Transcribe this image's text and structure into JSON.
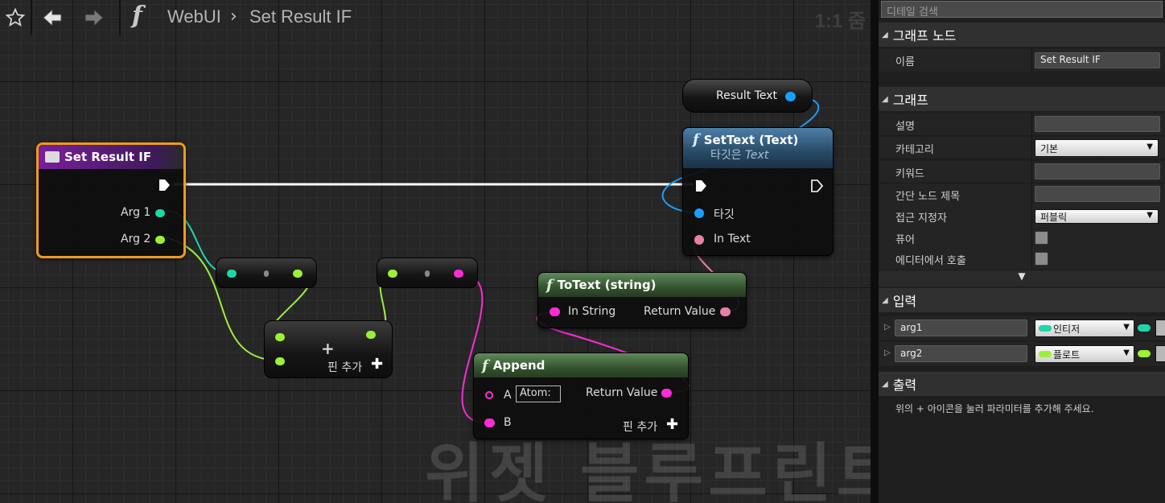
{
  "toolbar": {
    "breadcrumb_root": "WebUI",
    "breadcrumb_current": "Set Result IF",
    "zoom": "1:1 줌"
  },
  "watermark": "위젯 블루프린트",
  "nodes": {
    "entry": {
      "title": "Set Result IF",
      "arg1": "Arg 1",
      "arg2": "Arg 2"
    },
    "make_array": {
      "add_pin": "핀 추가"
    },
    "result_text": {
      "label": "Result Text"
    },
    "set_text": {
      "title": "SetText (Text)",
      "subtitle_prefix": "타깃은 ",
      "subtitle_target": "Text",
      "target": "타깃",
      "in_text": "In Text"
    },
    "to_text": {
      "title": "ToText (string)",
      "in_string": "In String",
      "return_value": "Return Value"
    },
    "append": {
      "title": "Append",
      "a": "A",
      "a_default": "Atom:",
      "b": "B",
      "return_value": "Return Value",
      "add_pin": "핀 추가"
    }
  },
  "details": {
    "search_placeholder": "디테일 검색",
    "graph_node_section": "그래프 노드",
    "name_label": "이름",
    "name_value": "Set Result IF",
    "graph_section": "그래프",
    "description_label": "설명",
    "category_label": "카테고리",
    "category_value": "기본",
    "keywords_label": "키워드",
    "compact_title_label": "간단 노드 제목",
    "access_label": "접근 지정자",
    "access_value": "퍼블릭",
    "pure_label": "퓨어",
    "call_in_editor_label": "에디터에서 호출",
    "inputs_section": "입력",
    "inputs": [
      {
        "name": "arg1",
        "type": "인티저",
        "color": "#1fd6a8"
      },
      {
        "name": "arg2",
        "type": "플로트",
        "color": "#9bf03a"
      }
    ],
    "outputs_section": "출력",
    "outputs_hint": "위의 + 아이콘을 눌러 파라미터를 추가해 주세요."
  },
  "colors": {
    "exec": "#ffffff",
    "integer": "#1fd6a8",
    "float": "#9bf03a",
    "string": "#ff2bd6",
    "text": "#e87fa6",
    "object": "#1a9fff",
    "selection": "#f19a1b"
  }
}
